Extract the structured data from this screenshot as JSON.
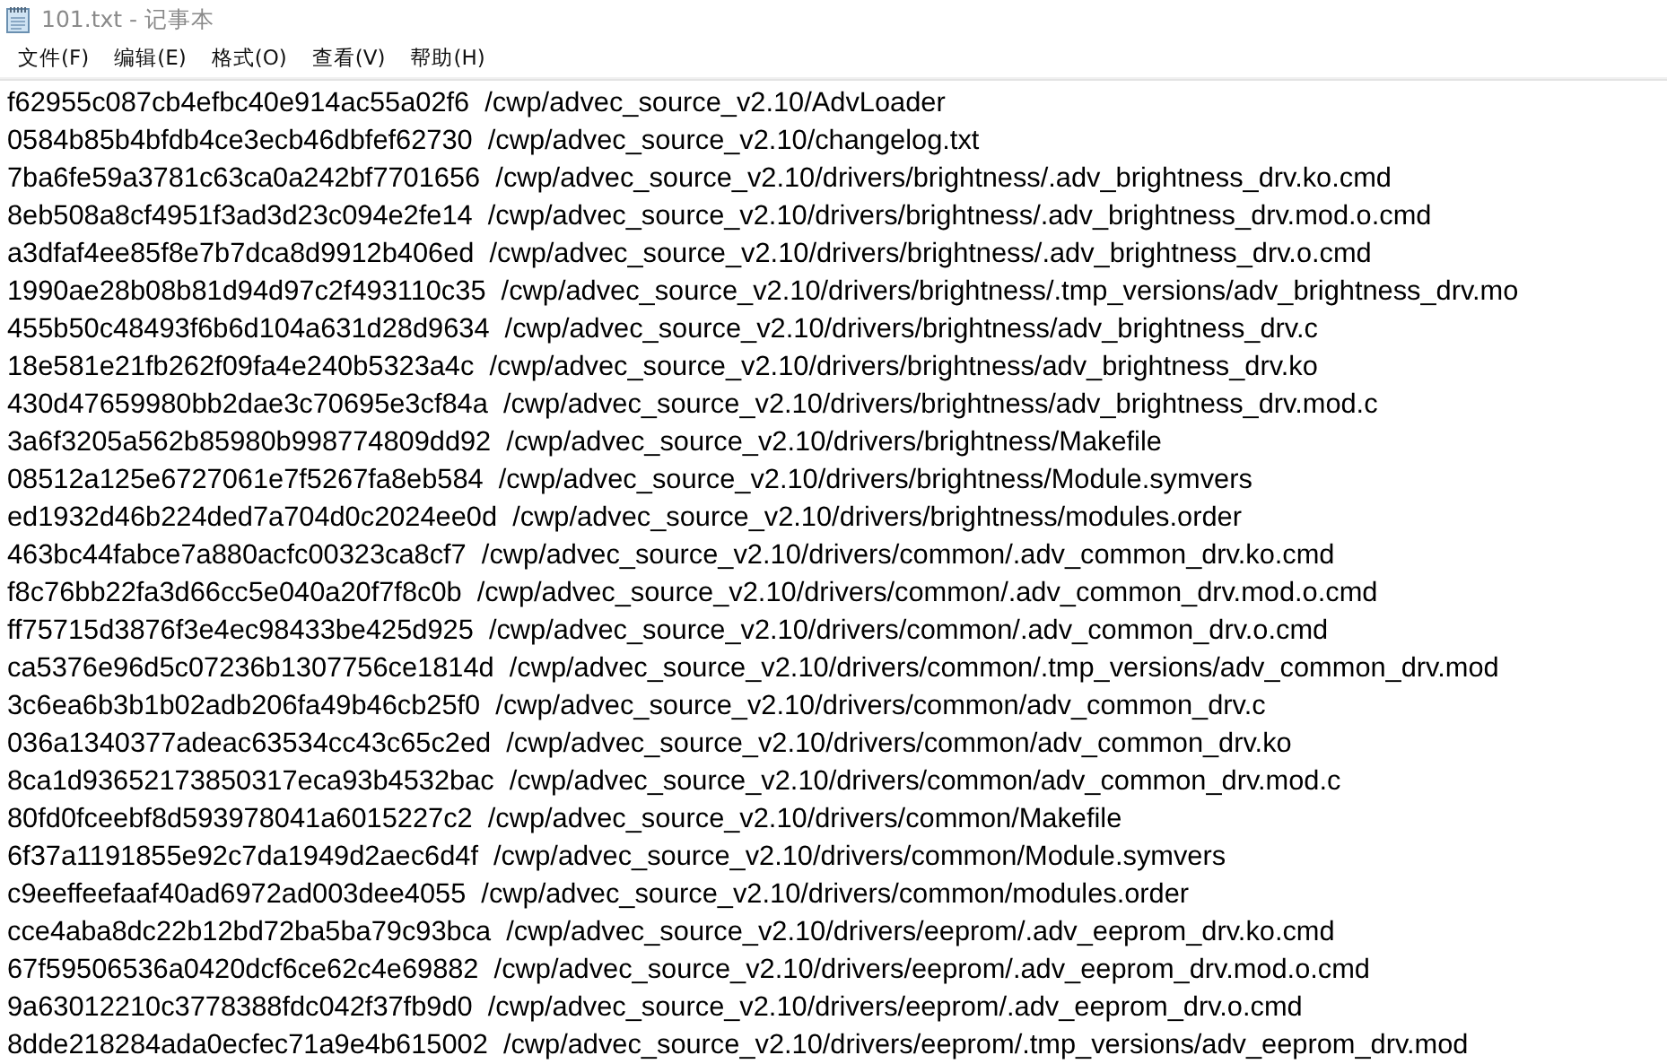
{
  "window": {
    "title": "101.txt - 记事本"
  },
  "menu": [
    "文件(F)",
    "编辑(E)",
    "格式(O)",
    "查看(V)",
    "帮助(H)"
  ],
  "lines": [
    "f62955c087cb4efbc40e914ac55a02f6  /cwp/advec_source_v2.10/AdvLoader",
    "0584b85b4bfdb4ce3ecb46dbfef62730  /cwp/advec_source_v2.10/changelog.txt",
    "7ba6fe59a3781c63ca0a242bf7701656  /cwp/advec_source_v2.10/drivers/brightness/.adv_brightness_drv.ko.cmd",
    "8eb508a8cf4951f3ad3d23c094e2fe14  /cwp/advec_source_v2.10/drivers/brightness/.adv_brightness_drv.mod.o.cmd",
    "a3dfaf4ee85f8e7b7dca8d9912b406ed  /cwp/advec_source_v2.10/drivers/brightness/.adv_brightness_drv.o.cmd",
    "1990ae28b08b81d94d97c2f493110c35  /cwp/advec_source_v2.10/drivers/brightness/.tmp_versions/adv_brightness_drv.mo",
    "455b50c48493f6b6d104a631d28d9634  /cwp/advec_source_v2.10/drivers/brightness/adv_brightness_drv.c",
    "18e581e21fb262f09fa4e240b5323a4c  /cwp/advec_source_v2.10/drivers/brightness/adv_brightness_drv.ko",
    "430d47659980bb2dae3c70695e3cf84a  /cwp/advec_source_v2.10/drivers/brightness/adv_brightness_drv.mod.c",
    "3a6f3205a562b85980b998774809dd92  /cwp/advec_source_v2.10/drivers/brightness/Makefile",
    "08512a125e6727061e7f5267fa8eb584  /cwp/advec_source_v2.10/drivers/brightness/Module.symvers",
    "ed1932d46b224ded7a704d0c2024ee0d  /cwp/advec_source_v2.10/drivers/brightness/modules.order",
    "463bc44fabce7a880acfc00323ca8cf7  /cwp/advec_source_v2.10/drivers/common/.adv_common_drv.ko.cmd",
    "f8c76bb22fa3d66cc5e040a20f7f8c0b  /cwp/advec_source_v2.10/drivers/common/.adv_common_drv.mod.o.cmd",
    "ff75715d3876f3e4ec98433be425d925  /cwp/advec_source_v2.10/drivers/common/.adv_common_drv.o.cmd",
    "ca5376e96d5c07236b1307756ce1814d  /cwp/advec_source_v2.10/drivers/common/.tmp_versions/adv_common_drv.mod",
    "3c6ea6b3b1b02adb206fa49b46cb25f0  /cwp/advec_source_v2.10/drivers/common/adv_common_drv.c",
    "036a1340377adeac63534cc43c65c2ed  /cwp/advec_source_v2.10/drivers/common/adv_common_drv.ko",
    "8ca1d93652173850317eca93b4532bac  /cwp/advec_source_v2.10/drivers/common/adv_common_drv.mod.c",
    "80fd0fceebf8d593978041a6015227c2  /cwp/advec_source_v2.10/drivers/common/Makefile",
    "6f37a1191855e92c7da1949d2aec6d4f  /cwp/advec_source_v2.10/drivers/common/Module.symvers",
    "c9eeffeefaaf40ad6972ad003dee4055  /cwp/advec_source_v2.10/drivers/common/modules.order",
    "cce4aba8dc22b12bd72ba5ba79c93bca  /cwp/advec_source_v2.10/drivers/eeprom/.adv_eeprom_drv.ko.cmd",
    "67f59506536a0420dcf6ce62c4e69882  /cwp/advec_source_v2.10/drivers/eeprom/.adv_eeprom_drv.mod.o.cmd",
    "9a63012210c3778388fdc042f37fb9d0  /cwp/advec_source_v2.10/drivers/eeprom/.adv_eeprom_drv.o.cmd",
    "8dde218284ada0ecfec71a9e4b615002  /cwp/advec_source_v2.10/drivers/eeprom/.tmp_versions/adv_eeprom_drv.mod"
  ]
}
